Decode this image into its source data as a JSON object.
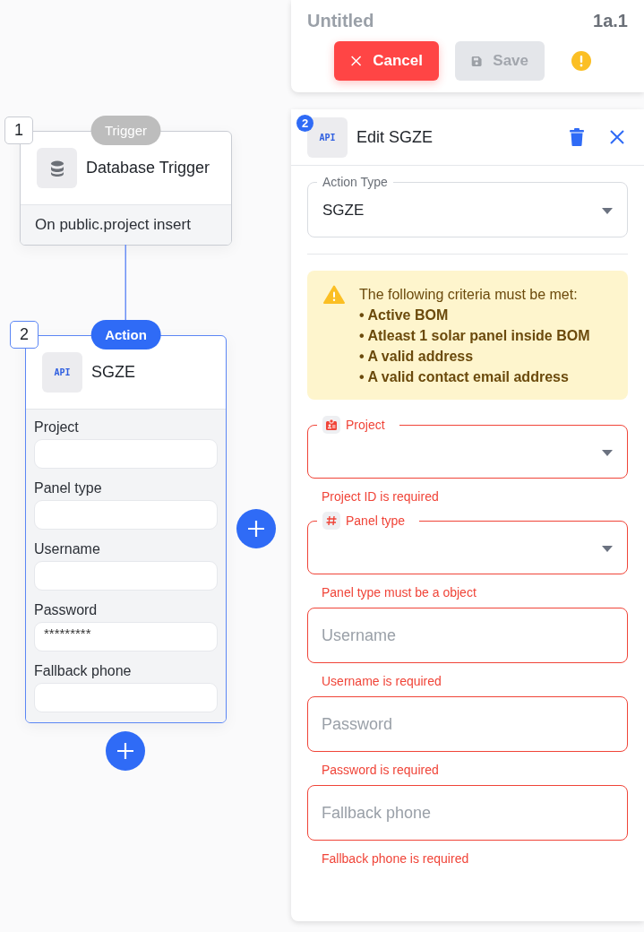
{
  "header": {
    "title": "Untitled",
    "version": "1a.1",
    "buttons": [
      {
        "kind": "cancel",
        "label": "Cancel",
        "disabled": false
      },
      {
        "kind": "save",
        "label": "Save",
        "disabled": true
      }
    ]
  },
  "canvas": {
    "nodes": [
      {
        "kind": "trigger",
        "number": "1",
        "badge": "Trigger",
        "title": "Database Trigger",
        "subtitle": "On public.project insert"
      },
      {
        "kind": "action",
        "number": "2",
        "badge": "Action",
        "icon_text": "API",
        "title": "SGZE",
        "fields": [
          {
            "label": "Project"
          },
          {
            "label": "Panel type"
          },
          {
            "label": "Username"
          },
          {
            "label": "Password",
            "value": "*********"
          },
          {
            "label": "Fallback phone"
          }
        ]
      }
    ]
  },
  "panel": {
    "step": "2",
    "icon_text": "API",
    "title": "Edit SGZE",
    "action_type": {
      "label": "Action Type",
      "value": "SGZE"
    },
    "notice": {
      "heading": "The following criteria must be met:",
      "items": [
        "• Active BOM",
        "• Atleast 1 solar panel inside BOM",
        "• A valid address",
        "• A valid contact email address"
      ]
    },
    "fields": [
      {
        "kind": "record",
        "label": "Project",
        "error": "Project ID is required"
      },
      {
        "kind": "number",
        "label": "Panel type",
        "error": "Panel type must be a object"
      },
      {
        "kind": "text",
        "placeholder": "Username",
        "error": "Username is required"
      },
      {
        "kind": "text",
        "placeholder": "Password",
        "error": "Password is required"
      },
      {
        "kind": "text",
        "placeholder": "Fallback phone",
        "error": "Fallback phone is required"
      }
    ]
  }
}
